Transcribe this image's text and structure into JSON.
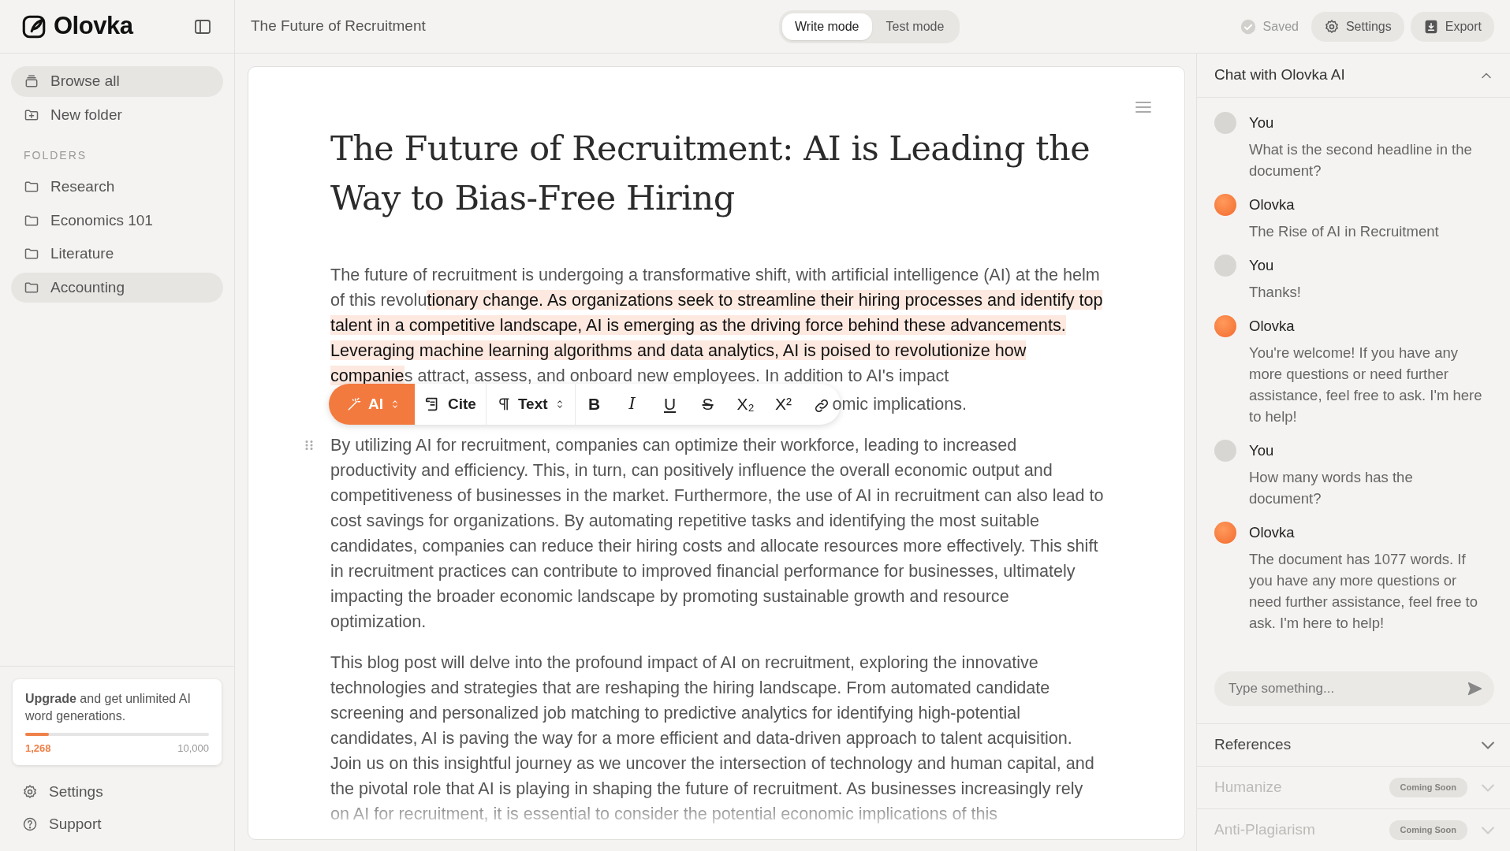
{
  "app": {
    "name": "Olovka"
  },
  "sidebar": {
    "nav": [
      {
        "label": "Browse all",
        "kind": "browse",
        "selected": true
      },
      {
        "label": "New folder",
        "kind": "new-folder",
        "selected": false
      }
    ],
    "folders_heading": "FOLDERS",
    "folders": [
      {
        "label": "Research",
        "selected": false
      },
      {
        "label": "Economics 101",
        "selected": false
      },
      {
        "label": "Literature",
        "selected": false
      },
      {
        "label": "Accounting",
        "selected": true
      }
    ],
    "upgrade": {
      "text": "**Upgrade** and get unlimited AI word generations.",
      "level": 0.1268,
      "used": "1,268",
      "limit": "10,000"
    },
    "footer": [
      {
        "label": "Settings",
        "kind": "settings"
      },
      {
        "label": "Support",
        "kind": "support"
      }
    ]
  },
  "topbar": {
    "document_title": "The Future of Recruitment",
    "modes": [
      {
        "label": "Write mode",
        "selected": true
      },
      {
        "label": "Test mode",
        "selected": false
      }
    ],
    "saved": "Saved",
    "actions": [
      {
        "label": "Settings",
        "kind": "settings"
      },
      {
        "label": "Export",
        "kind": "export"
      }
    ]
  },
  "editor": {
    "title": "The Future of Recruitment: AI is Leading the Way to Bias-Free Hiring",
    "paragraphs": [
      {
        "segments": [
          {
            "text": "The future of recruitment is undergoing a transformative shift, with artificial intelligence (AI) at the helm of this revolu",
            "selected": false
          },
          {
            "text": "tionary change. As organizations seek to streamline their hiring processes and identify top talent in a competitive landscape, AI is emerging as the driving force behind these advancements. Leveraging machine learning algorithms and data analytics, AI is poised to revolutionize how companie",
            "selected": true
          },
          {
            "text": "s attract, assess, and onboard new employees. In addition to AI's impact",
            "selected": false
          }
        ]
      },
      {
        "segments": [
          {
            "text": "By utilizing AI for recruitment, companies can optimize their workforce, leading to increased productivity and efficiency. This, in turn, can positively influence the overall economic output and competitiveness of businesses in the market. Furthermore, the use of AI in recruitment can also lead to cost savings for organizations. By automating repetitive tasks and identifying the most suitable candidates, companies can reduce their hiring costs and allocate resources more effectively. This shift in recruitment practices can contribute to improved financial performance for businesses, ultimately impacting the broader economic landscape by promoting sustainable growth and resource optimization.",
            "selected": false
          }
        ]
      },
      {
        "segments": [
          {
            "text": "This blog post will delve into the profound impact of AI on recruitment, exploring the innovative technologies and strategies that are reshaping the hiring landscape. From automated candidate screening and personalized job matching to predictive analytics for identifying high-potential candidates, AI is paving the way for a more efficient and data-driven approach to talent acquisition. Join us on this insightful journey as we uncover the intersection of technology and human capital, and the pivotal role that AI is playing in shaping the future of recruitment. As businesses increasingly rely on AI for recruitment, it is essential to consider the potential economic implications of this",
            "selected": false
          }
        ]
      }
    ],
    "covered_fragment": "omic implications.",
    "toolbar": {
      "ai": "AI",
      "cite": "Cite",
      "text_style": "Text",
      "formats": [
        {
          "label": "B",
          "kind": "bold"
        },
        {
          "label": "I",
          "kind": "italic"
        },
        {
          "label": "U",
          "kind": "underline"
        },
        {
          "label": "S",
          "kind": "strike"
        },
        {
          "label": "X₂",
          "kind": "subscript"
        },
        {
          "label": "X²",
          "kind": "superscript"
        }
      ]
    }
  },
  "chat": {
    "title": "Chat with Olovka AI",
    "expanded": true,
    "messages": [
      {
        "author": "You",
        "kind": "user",
        "text": "What is the second headline in the document?"
      },
      {
        "author": "Olovka",
        "kind": "ai",
        "text": "The Rise of AI in Recruitment"
      },
      {
        "author": "You",
        "kind": "user",
        "text": "Thanks!"
      },
      {
        "author": "Olovka",
        "kind": "ai",
        "text": "You're welcome! If you have any more questions or need further assistance, feel free to ask. I'm here to help!"
      },
      {
        "author": "You",
        "kind": "user",
        "text": "How many words has the document?"
      },
      {
        "author": "Olovka",
        "kind": "ai",
        "text": "The document has 1077 words. If you have any more questions or need further assistance, feel free to ask. I'm here to help!"
      }
    ],
    "input": {
      "placeholder": "Type something..."
    }
  },
  "sections": [
    {
      "label": "References",
      "disabled": false
    },
    {
      "label": "Humanize",
      "disabled": true,
      "badge": "Coming Soon"
    },
    {
      "label": "Anti-Plagiarism",
      "disabled": true,
      "badge": "Coming Soon"
    }
  ]
}
